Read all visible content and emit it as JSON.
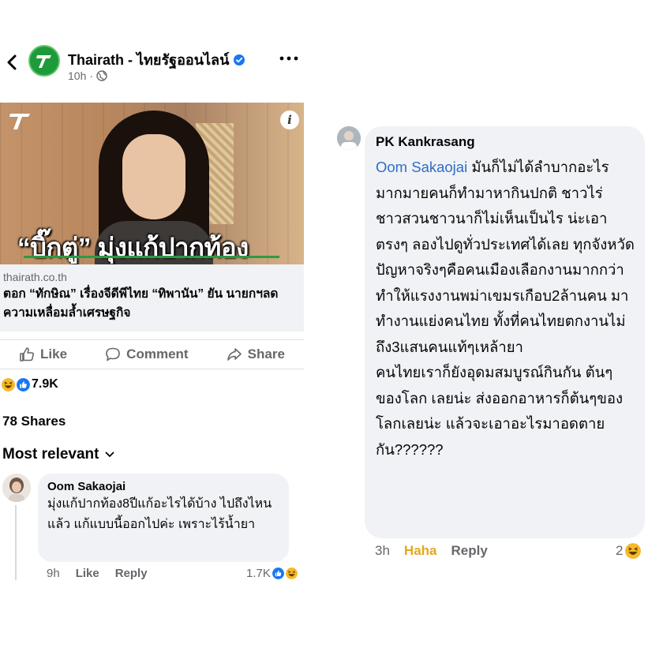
{
  "post": {
    "page_name": "Thairath - ไทยรัฐออนไลน์",
    "time": "10h",
    "time_separator": "·",
    "image_headline": "“บิ๊กตู่” มุ่งแก้ปากท้อง",
    "link_domain": "thairath.co.th",
    "link_title": "ตอก “ทักษิณ” เรื่องจีดีพีไทย “ทิพานัน” ยัน นายกฯลดความเหลื่อมล้ำเศรษฐกิจ",
    "actions": {
      "like": "Like",
      "comment": "Comment",
      "share": "Share"
    },
    "reaction_count": "7.9K",
    "shares": "78 Shares",
    "sort_label": "Most relevant"
  },
  "comment_left": {
    "name": "Oom Sakaojai",
    "text": "มุ่งแก้ปากท้อง8ปีแก้อะไรได้บ้าง ไปถึงไหนแล้ว แก้แบบนี้ออกไปค่ะ เพราะไร้น้ำยา",
    "time": "9h",
    "like": "Like",
    "reply": "Reply",
    "count": "1.7K"
  },
  "comment_right": {
    "name": "PK Kankrasang",
    "mention": "Oom Sakaojai",
    "text": " มันก็ไม่ได้ลำบากอะไรมากมายคนก็ทำมาหากินปกติ ชาวไร่ชาวสวนชาวนาก็ไม่เห็นเป็นไร น่ะเอาตรงๆ ลองไปดูทั่วประเทศได้เลย ทุกจังหวัด\nปัญหาจริงๆคือคนเมืองเลือกงานมากกว่า\nทำให้แรงงานพม่าเขมรเกือบ2ล้านคน มาทำงานแย่งคนไทย ทั้งที่คนไทยตกงานไม่ถึง3แสนคนแท้ๆเหล้ายา\nคนไทยเราก็ยังอุดมสมบูรณ์กินกัน ต้นๆของโลก เลยน่ะ ส่งออกอาหารก็ต้นๆของโลกเลยน่ะ แล้วจะเอาอะไรมาอดตายกัน??????",
    "time": "3h",
    "haha": "Haha",
    "reply": "Reply",
    "count": "2"
  },
  "colors": {
    "facebook_blue": "#1877f2",
    "haha_yellow": "#f7b928",
    "thairath_green": "#1f9a3a",
    "mention_blue": "#2f6dc9"
  },
  "icons": [
    "back-arrow-icon",
    "thairath-logo-icon",
    "verified-icon",
    "globe-icon",
    "more-icon",
    "info-icon",
    "like-icon",
    "comment-icon",
    "share-icon",
    "haha-icon",
    "thumbs-up-reaction-icon",
    "chevron-down-icon"
  ]
}
